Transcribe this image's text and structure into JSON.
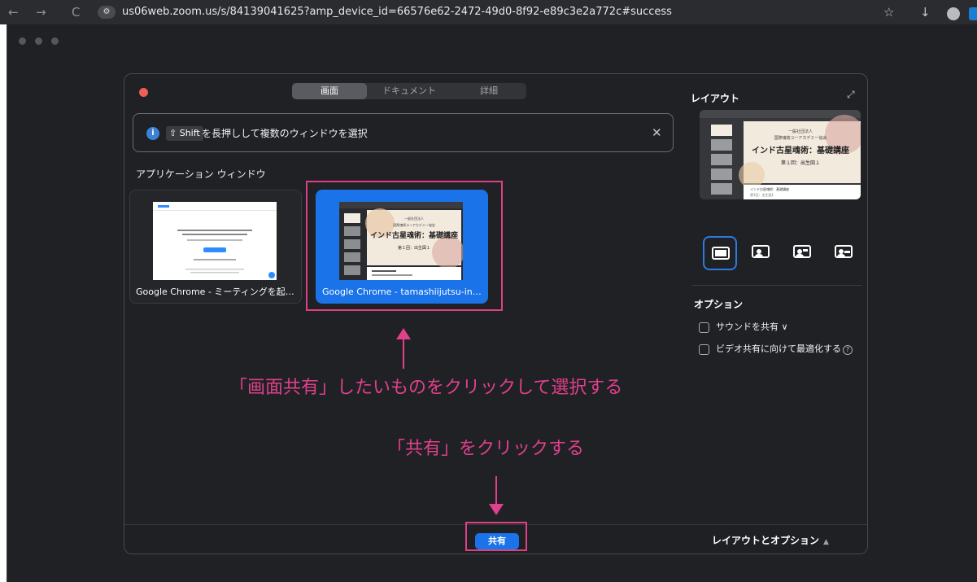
{
  "browser": {
    "nav_back": "←",
    "nav_forward": "→",
    "nav_reload": "C",
    "site_settings_icon": "site-settings-icon",
    "url": "us06web.zoom.us/s/84139041625?amp_device_id=66576e62-2472-49d0-8f92-e89c3e2a772c#success",
    "star": "☆",
    "download": "↓"
  },
  "dialog": {
    "tabs": [
      {
        "label": "画面",
        "active": true
      },
      {
        "label": "ドキュメント",
        "active": false
      },
      {
        "label": "詳細",
        "active": false
      }
    ],
    "info": {
      "icon": "i",
      "shift_key": "⇧ Shift",
      "text": "を長押しして複数のウィンドウを選択",
      "close": "✕"
    },
    "section_label": "アプリケーション ウィンドウ",
    "windows": [
      {
        "title": "Google Chrome - ミーティングを起…",
        "selected": false
      },
      {
        "title": "Google Chrome - tamashiijutsu-in…",
        "selected": true
      }
    ],
    "right_panel": {
      "layout_title": "レイアウト",
      "expand_icon": "⤢",
      "preview": {
        "line1": "一般社団法人",
        "line2": "国際魂術ユーアカデミー協会",
        "heading": "インド古星魂術：基礎講座",
        "subheading": "第１回：出生図１",
        "mini1": "インド古星魂術：基礎講座",
        "mini2": "第1回：出生図1"
      },
      "options_title": "オプション",
      "options": [
        {
          "label": "サウンドを共有",
          "suffix": "∨",
          "checked": false
        },
        {
          "label": "ビデオ共有に向けて最適化する",
          "suffix": "?",
          "checked": false
        }
      ]
    },
    "share_button": "共有",
    "layout_options_label": "レイアウトとオプション",
    "layout_options_caret": "▲"
  },
  "annotations": {
    "select_instruction": "「画面共有」したいものをクリックして選択する",
    "share_instruction": "「共有」をクリックする"
  },
  "colors": {
    "accent_blue": "#1a73e8",
    "annotation_pink": "#e0408c",
    "dialog_bg": "#202124"
  }
}
